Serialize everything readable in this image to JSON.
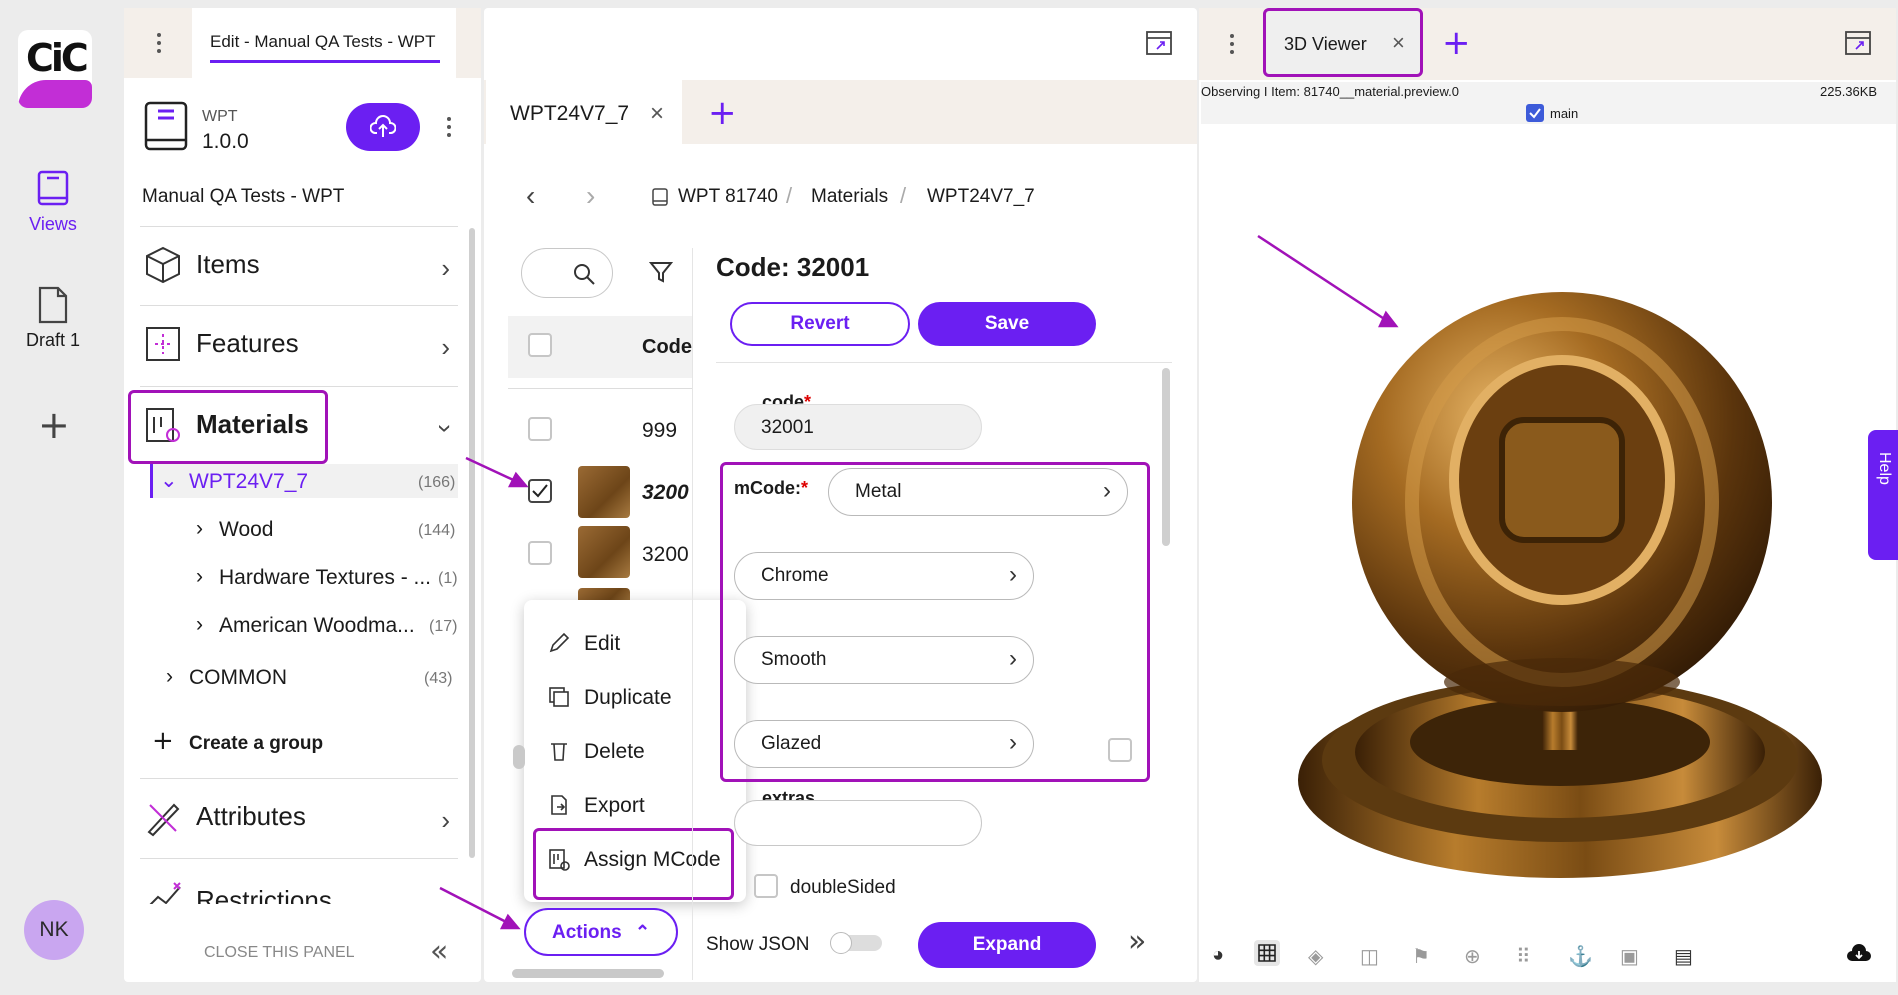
{
  "app": {
    "logo_text": "CiC",
    "user_initials": "NK"
  },
  "rail": {
    "views_label": "Views",
    "draft_label": "Draft 1"
  },
  "left_panel": {
    "tab_title": "Edit - Manual QA Tests - WPT",
    "catalog": {
      "code": "WPT",
      "version": "1.0.0",
      "name": "Manual QA Tests - WPT"
    },
    "nav": {
      "items": "Items",
      "features": "Features",
      "materials": "Materials",
      "attributes": "Attributes",
      "restrictions": "Restrictions"
    },
    "tree": [
      {
        "label": "WPT24V7_7",
        "count": "(166)"
      },
      {
        "label": "Wood",
        "count": "(144)"
      },
      {
        "label": "Hardware Textures - ...",
        "count": "(1)"
      },
      {
        "label": "American Woodma...",
        "count": "(17)"
      },
      {
        "label": "COMMON",
        "count": "(43)"
      }
    ],
    "create_group": "Create a group",
    "close_panel": "CLOSE THIS PANEL"
  },
  "middle": {
    "tab_title": "WPT24V7_7",
    "breadcrumb": [
      "WPT 81740",
      "Materials",
      "WPT24V7_7"
    ],
    "table_header": "Code",
    "rows": [
      {
        "code": "999"
      },
      {
        "code": "3200"
      },
      {
        "code": "3200"
      }
    ],
    "context_menu": [
      "Edit",
      "Duplicate",
      "Delete",
      "Export",
      "Assign MCode"
    ],
    "actions_label": "Actions"
  },
  "form": {
    "heading": "Code: 32001",
    "revert_label": "Revert",
    "save_label": "Save",
    "code_label": "code",
    "code_value": "32001",
    "mcode_label": "mCode:",
    "mcode_values": [
      "Metal",
      "Chrome",
      "Smooth",
      "Glazed"
    ],
    "extras_label": "extras",
    "double_sided_label": "doubleSided",
    "show_json_label": "Show JSON",
    "expand_label": "Expand"
  },
  "viewer": {
    "tab_title": "3D Viewer",
    "observing": "Observing I Item: 81740__material.preview.0",
    "size": "225.36KB",
    "layer_label": "main",
    "help_label": "Help"
  },
  "colors": {
    "accent": "#6b1ff2",
    "highlight": "#a112b8",
    "brand": "#c22ed6"
  }
}
